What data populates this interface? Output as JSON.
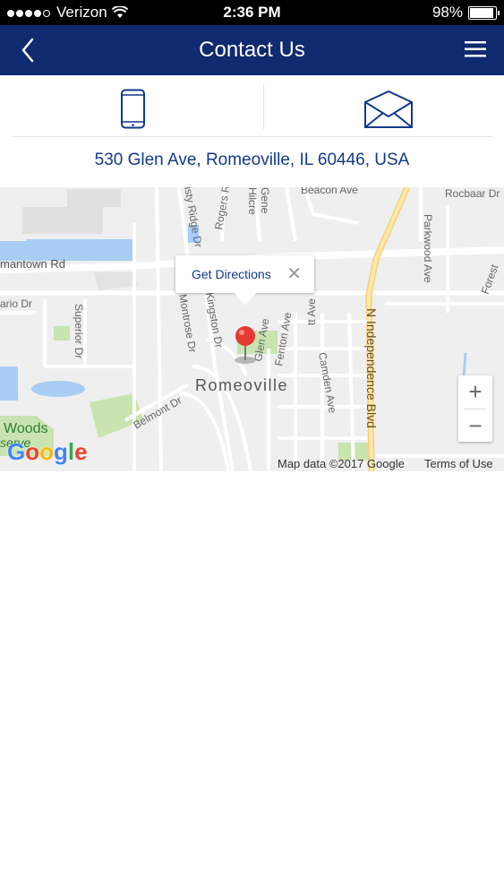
{
  "status_bar": {
    "carrier": "Verizon",
    "time": "2:36 PM",
    "battery": "98%"
  },
  "header": {
    "title": "Contact Us"
  },
  "contact": {
    "address": "530 Glen Ave, Romeoville, IL 60446, USA"
  },
  "map": {
    "popup_text": "Get Directions",
    "close_glyph": "✕",
    "zoom_in": "+",
    "zoom_out": "−",
    "attribution": "Map data ©2017 Google",
    "terms": "Terms of Use",
    "logo": "Google",
    "labels": {
      "beacon_ave": "Beacon Ave",
      "rocbaar_dr": "Rocbaar Dr",
      "parkwood_ave": "Parkwood Ave",
      "forest": "Forest",
      "germantown_rd": "mantown Rd",
      "ontario_dr": "ario Dr",
      "superior_dr": "Superior Dr",
      "misty_ridge_dr": "isty Ridge Dr",
      "rogers_rd": "Rogers R",
      "hillcrest": "Hilcre",
      "gene": "Gene",
      "montrose_dr": "Montrose Dr",
      "kingston_dr": "Kingston Dr",
      "glen_ave": "Glen Ave",
      "fenton_ave": "Fenton Ave",
      "st_ave": "tt Ave",
      "n_independence_blvd": "N Independence Blvd",
      "camden_ave": "Camden Ave",
      "romeoville": "Romeoville",
      "belmont_dr": "Belmont Dr",
      "woods": "Woods",
      "serve": "serve"
    }
  },
  "colors": {
    "nav_bg": "#0f2a6e",
    "accent_text": "#123a8c",
    "pin": "#e53935"
  }
}
